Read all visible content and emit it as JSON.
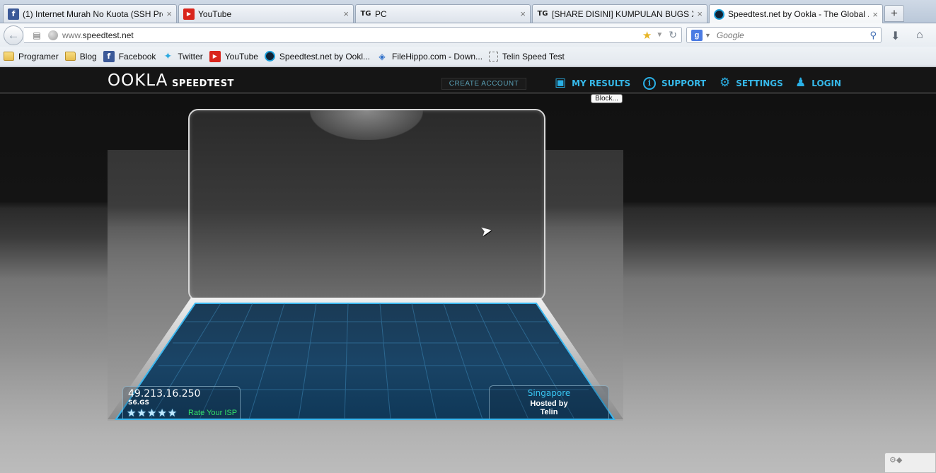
{
  "browser": {
    "tabs": [
      {
        "icon": "facebook-favicon",
        "label": "(1) Internet Murah No Kuota (SSH Pre...",
        "active": false
      },
      {
        "icon": "youtube-favicon",
        "label": "YouTube",
        "active": false
      },
      {
        "icon": "tg-favicon",
        "label": "PC",
        "active": false
      },
      {
        "icon": "tg-favicon",
        "label": "[SHARE DISINI] KUMPULAN BUGS XL ...",
        "active": false
      },
      {
        "icon": "ookla-favicon",
        "label": "Speedtest.net by Ookla - The Global ...",
        "active": true
      }
    ],
    "tab_close_glyph": "×",
    "new_tab_glyph": "+",
    "address": {
      "prefix": "www.",
      "domain": "speedtest.net"
    },
    "search": {
      "placeholder": "Google",
      "engine_letter": "g"
    },
    "bookmarks": [
      {
        "icon": "folder-icon",
        "label": "Programer"
      },
      {
        "icon": "folder-icon",
        "label": "Blog"
      },
      {
        "icon": "facebook-favicon",
        "label": "Facebook"
      },
      {
        "icon": "twitter-favicon",
        "label": "Twitter"
      },
      {
        "icon": "youtube-favicon",
        "label": "YouTube"
      },
      {
        "icon": "ookla-favicon",
        "label": "Speedtest.net by Ookl..."
      },
      {
        "icon": "filehippo-favicon",
        "label": "FileHippo.com - Down..."
      },
      {
        "icon": "blank-page-icon",
        "label": "Telin Speed Test"
      }
    ]
  },
  "site": {
    "logo": "OOKLA",
    "logo_sub": "SPEEDTEST",
    "create_account": "CREATE ACCOUNT",
    "nav": {
      "my_results": "MY RESULTS",
      "support": "SUPPORT",
      "settings": "SETTINGS",
      "login": "LOGIN"
    },
    "tooltip": "Block...",
    "isp": {
      "ip": "49.213.16.250",
      "name": "S6.GS",
      "rating": 5,
      "stars": "★★★★★",
      "rate_label": "Rate Your ISP"
    },
    "server": {
      "city": "Singapore",
      "hosted_by": "Hosted by",
      "host": "Telin"
    }
  },
  "colors": {
    "accent": "#36b9ea",
    "rate_green": "#33e06a",
    "header_bg": "#151515"
  }
}
